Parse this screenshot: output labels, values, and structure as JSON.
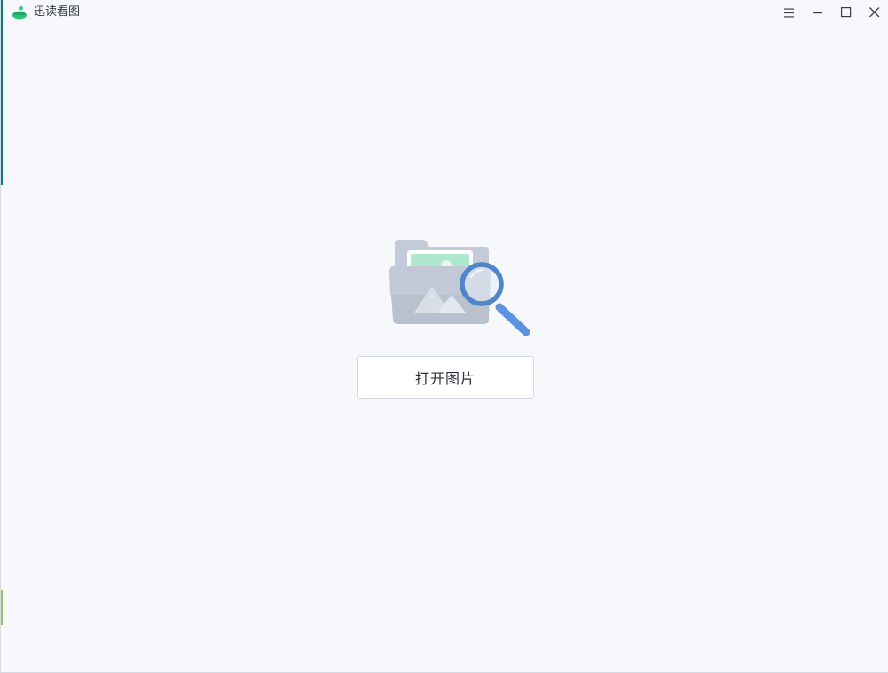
{
  "window": {
    "title": "迅读看图",
    "controls": {
      "menu_icon": "hamburger-menu-icon",
      "minimize_icon": "minimize-icon",
      "maximize_icon": "maximize-icon",
      "close_icon": "close-icon"
    }
  },
  "main": {
    "illustration_icon": "folder-image-search-icon",
    "open_button_label": "打开图片"
  },
  "colors": {
    "background": "#f7f8fc",
    "brand_green": "#2fc07a",
    "magnifier_blue": "#4a86d8"
  }
}
